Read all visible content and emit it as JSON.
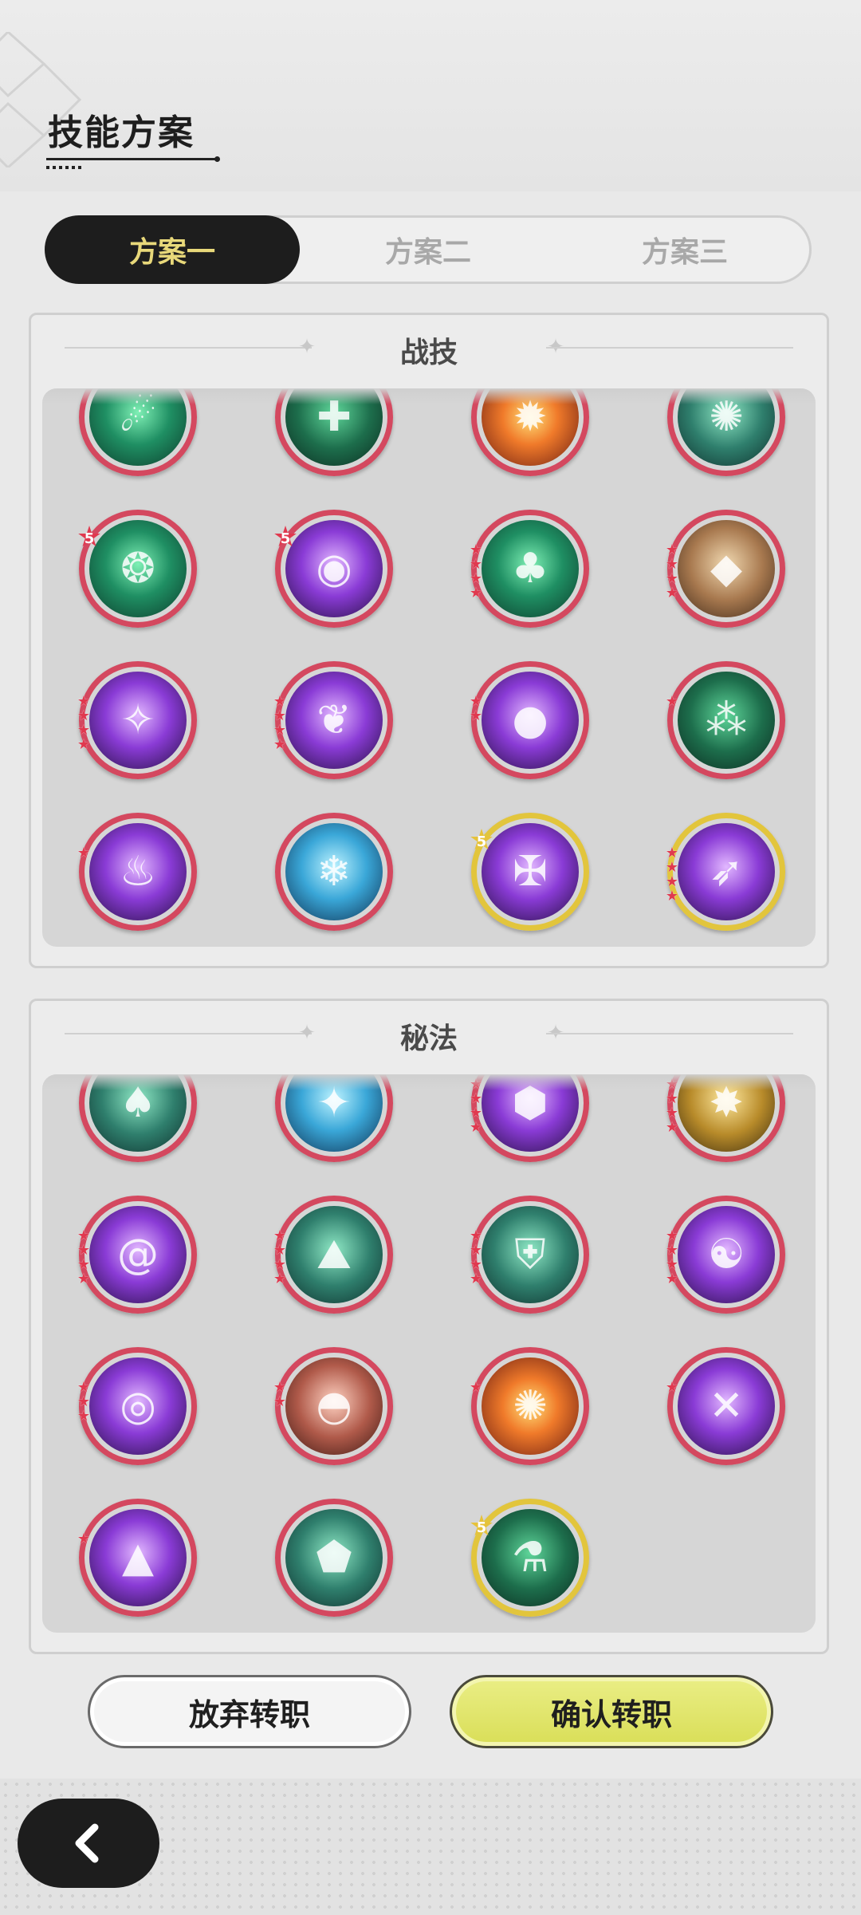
{
  "page": {
    "title": "技能方案"
  },
  "tabs": [
    {
      "label": "方案一",
      "active": true
    },
    {
      "label": "方案二",
      "active": false
    },
    {
      "label": "方案三",
      "active": false
    }
  ],
  "combat_section": {
    "title": "战技",
    "skills": [
      {
        "theme": "green",
        "icon": "green-comet-icon",
        "border": "red",
        "stars": 0,
        "badge": "",
        "partial": true
      },
      {
        "theme": "darkgreen",
        "icon": "green-plus-icon",
        "border": "red",
        "stars": 0,
        "badge": "",
        "partial": true
      },
      {
        "theme": "fire",
        "icon": "fireball-icon",
        "border": "red",
        "stars": 0,
        "badge": "",
        "partial": true
      },
      {
        "theme": "teal",
        "icon": "green-swirl-icon",
        "border": "red",
        "stars": 0,
        "badge": "",
        "partial": true
      },
      {
        "theme": "green",
        "icon": "thorn-ring-icon",
        "border": "red",
        "stars": 0,
        "badge": "5",
        "partial": false
      },
      {
        "theme": "purple",
        "icon": "void-eye-icon",
        "border": "red",
        "stars": 0,
        "badge": "5",
        "partial": false
      },
      {
        "theme": "green",
        "icon": "tree-stump-icon",
        "border": "red",
        "stars": 4,
        "badge": "",
        "partial": false
      },
      {
        "theme": "tan",
        "icon": "rock-shards-icon",
        "border": "red",
        "stars": 4,
        "badge": "",
        "partial": false
      },
      {
        "theme": "purple",
        "icon": "purple-star-icon",
        "border": "red",
        "stars": 4,
        "badge": "",
        "partial": false
      },
      {
        "theme": "purple",
        "icon": "purple-wings-icon",
        "border": "red",
        "stars": 4,
        "badge": "",
        "partial": false
      },
      {
        "theme": "purple",
        "icon": "purple-orb-icon",
        "border": "red",
        "stars": 2,
        "badge": "",
        "partial": false
      },
      {
        "theme": "darkgreen",
        "icon": "green-bubbles-icon",
        "border": "red",
        "stars": 1,
        "badge": "",
        "partial": false
      },
      {
        "theme": "purple",
        "icon": "purple-flame-icon",
        "border": "red",
        "stars": 1,
        "badge": "",
        "partial": false
      },
      {
        "theme": "blue",
        "icon": "ice-golem-icon",
        "border": "red",
        "stars": 0,
        "badge": "",
        "partial": false
      },
      {
        "theme": "purple",
        "icon": "purple-crest-icon",
        "border": "gold",
        "stars": 0,
        "badge": "5",
        "partial": false
      },
      {
        "theme": "purple",
        "icon": "purple-spear-icon",
        "border": "gold",
        "stars": 4,
        "badge": "",
        "partial": false
      }
    ]
  },
  "secret_section": {
    "title": "秘法",
    "skills": [
      {
        "theme": "teal",
        "icon": "tree-spirit-icon",
        "border": "red",
        "stars": 0,
        "badge": "",
        "partial": true
      },
      {
        "theme": "blue",
        "icon": "blue-star-icon",
        "border": "red",
        "stars": 0,
        "badge": "",
        "partial": true
      },
      {
        "theme": "purple",
        "icon": "purple-rock-icon",
        "border": "red",
        "stars": 4,
        "badge": "",
        "partial": true
      },
      {
        "theme": "gold",
        "icon": "golden-burst-icon",
        "border": "red",
        "stars": 4,
        "badge": "",
        "partial": true
      },
      {
        "theme": "purple",
        "icon": "purple-vortex-icon",
        "border": "red",
        "stars": 4,
        "badge": "",
        "partial": false
      },
      {
        "theme": "teal",
        "icon": "stone-golem-icon",
        "border": "red",
        "stars": 4,
        "badge": "",
        "partial": false
      },
      {
        "theme": "teal",
        "icon": "green-shield-icon",
        "border": "red",
        "stars": 4,
        "badge": "",
        "partial": false
      },
      {
        "theme": "purple",
        "icon": "purple-sage-icon",
        "border": "red",
        "stars": 4,
        "badge": "",
        "partial": false
      },
      {
        "theme": "purple",
        "icon": "purple-eye-icon",
        "border": "red",
        "stars": 3,
        "badge": "",
        "partial": false
      },
      {
        "theme": "rose",
        "icon": "red-dome-icon",
        "border": "red",
        "stars": 2,
        "badge": "",
        "partial": false
      },
      {
        "theme": "fire",
        "icon": "fire-ring-icon",
        "border": "red",
        "stars": 1,
        "badge": "",
        "partial": false
      },
      {
        "theme": "purple",
        "icon": "purple-cross-icon",
        "border": "red",
        "stars": 1,
        "badge": "",
        "partial": false
      },
      {
        "theme": "purple",
        "icon": "purple-triangle-icon",
        "border": "red",
        "stars": 1,
        "badge": "",
        "partial": false
      },
      {
        "theme": "teal",
        "icon": "crystal-rocks-icon",
        "border": "red",
        "stars": 0,
        "badge": "",
        "partial": false
      },
      {
        "theme": "darkgreen",
        "icon": "green-potion-icon",
        "border": "gold",
        "stars": 0,
        "badge": "5",
        "partial": false
      }
    ]
  },
  "buttons": {
    "cancel": "放弃转职",
    "confirm": "确认转职"
  },
  "nav": {
    "back_icon": "chevron-left-icon"
  },
  "colors": {
    "tab_active_bg": "#1d1d1d",
    "tab_active_text": "#e8d87a",
    "confirm_button": "#dfe36a",
    "skill_border_red": "#d4485f",
    "skill_border_gold": "#e2c53c"
  }
}
